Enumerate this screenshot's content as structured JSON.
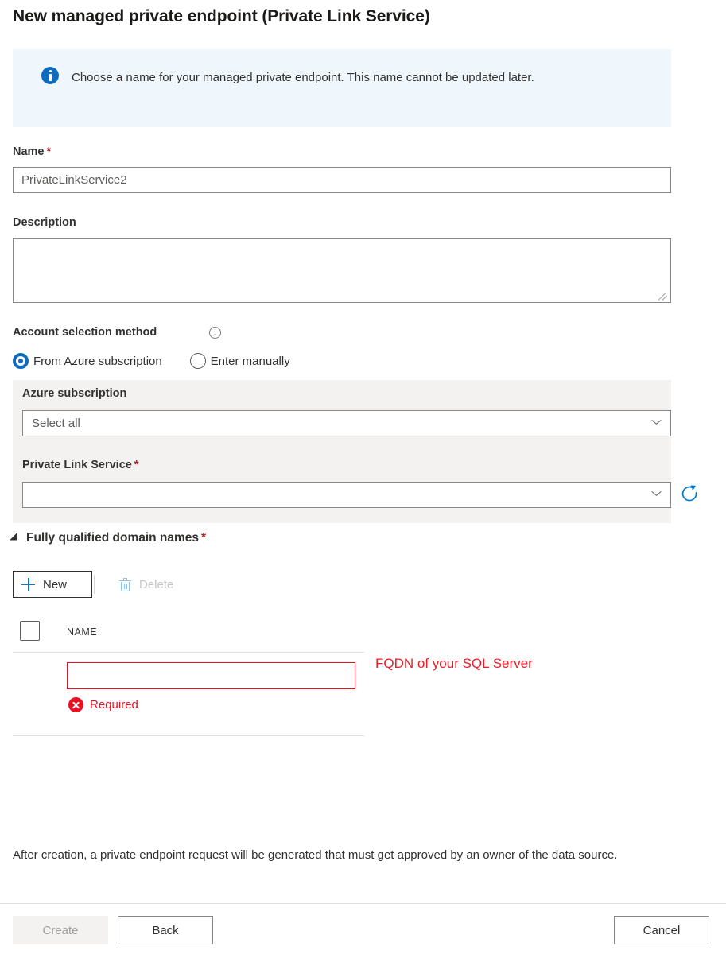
{
  "page": {
    "title": "New managed private endpoint (Private Link Service)"
  },
  "info_banner": {
    "icon": "info-circle-icon",
    "text": "Choose a name for your managed private endpoint. This name cannot be updated later."
  },
  "form": {
    "name": {
      "label": "Name",
      "required_marker": "*",
      "value": "PrivateLinkService2",
      "placeholder": "PrivateLinkService2"
    },
    "description": {
      "label": "Description",
      "value": "",
      "placeholder": ""
    },
    "account_selection": {
      "label": "Account selection method",
      "info_icon": "info-outline-icon",
      "info_glyph": "i",
      "options": [
        {
          "label": "From Azure subscription",
          "selected": true
        },
        {
          "label": "Enter manually",
          "selected": false
        }
      ]
    },
    "azure_subscription": {
      "label": "Azure subscription",
      "value": "Select all",
      "chevron": "chevron-down-icon"
    },
    "private_link_service": {
      "label": "Private Link Service",
      "required_marker": "*",
      "value": "",
      "chevron": "chevron-down-icon",
      "refresh_icon": "refresh-icon"
    }
  },
  "fqdn_section": {
    "toggle_label": "Fully qualified domain names",
    "required_marker": "*",
    "expanded": true,
    "toolbar": {
      "new_label": "New",
      "new_icon": "plus-icon",
      "delete_label": "Delete",
      "delete_icon": "trash-icon",
      "delete_disabled": true
    },
    "table": {
      "columns": [
        "NAME"
      ],
      "rows": [
        {
          "name_value": "",
          "error_icon": "error-x-icon",
          "error_text": "Required"
        }
      ]
    },
    "annotation": "FQDN of your SQL Server"
  },
  "footer": {
    "note": "After creation, a private endpoint request will be generated that must get approved by an owner of the data source.",
    "buttons": {
      "create": "Create",
      "back": "Back",
      "cancel": "Cancel"
    }
  },
  "colors": {
    "accent_blue": "#0078d4",
    "info_banner_bg": "#eff6fc",
    "panel_grey": "#f3f2f1",
    "error_red": "#e81123",
    "annotation_red": "#ee1c25",
    "required_star": "#a4262c"
  }
}
